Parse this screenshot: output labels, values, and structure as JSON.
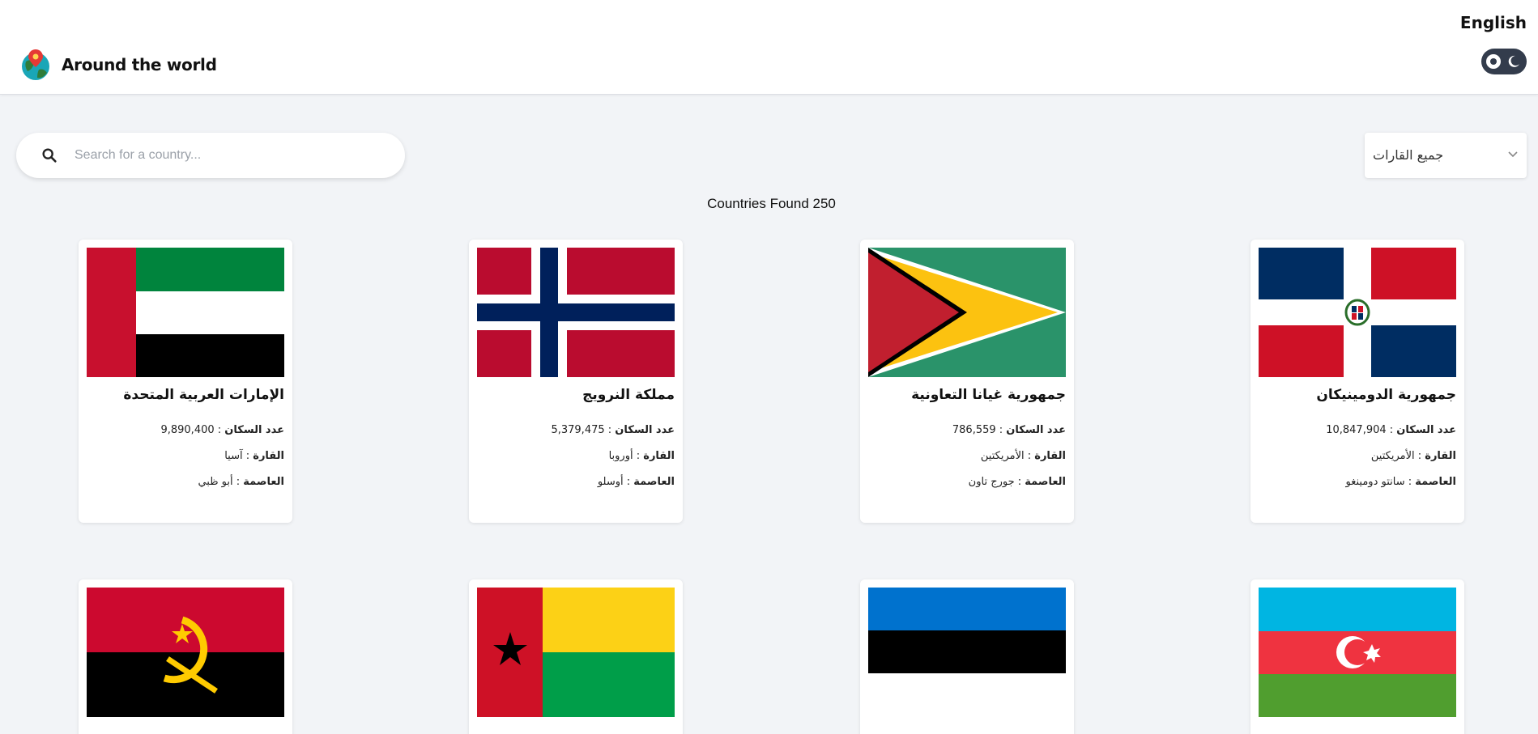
{
  "header": {
    "title": "Around the world",
    "language": "English"
  },
  "search": {
    "placeholder": "Search for a country..."
  },
  "filter": {
    "selected": "جميع القارات"
  },
  "count_text": "Countries Found 250",
  "labels": {
    "population": "عدد السكان",
    "continent": "القارة",
    "capital": "العاصمة"
  },
  "countries": [
    {
      "name": "جمهورية الدومينيكان",
      "population": "10,847,904",
      "continent": "الأمريكتين",
      "capital": "سانتو دومينغو",
      "flag": "dominican-republic-flag"
    },
    {
      "name": "جمهورية غيانا التعاونية",
      "population": "786,559",
      "continent": "الأمريكتين",
      "capital": "جورج تاون",
      "flag": "guyana-flag"
    },
    {
      "name": "مملكة النرويج",
      "population": "5,379,475",
      "continent": "أوروبا",
      "capital": "أوسلو",
      "flag": "norway-flag"
    },
    {
      "name": "الإمارات العربية المتحدة",
      "population": "9,890,400",
      "continent": "آسيا",
      "capital": "أبو ظبي",
      "flag": "uae-flag"
    },
    {
      "flag": "azerbaijan-flag"
    },
    {
      "flag": "estonia-flag"
    },
    {
      "flag": "guinea-bissau-flag"
    },
    {
      "flag": "angola-flag"
    }
  ],
  "colors": {
    "background": "#f2f4f7",
    "toggle": "#333c4c"
  }
}
